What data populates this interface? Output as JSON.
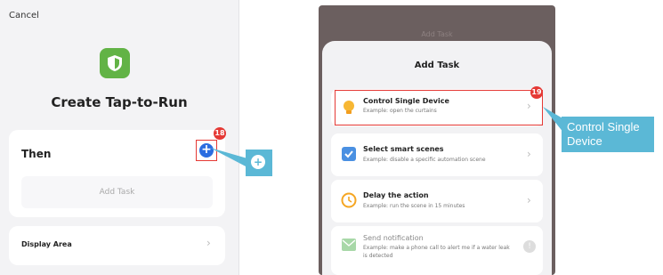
{
  "left_screen": {
    "cancel_label": "Cancel",
    "title": "Create Tap-to-Run",
    "then_label": "Then",
    "add_button_glyph": "+",
    "step_badge": "18",
    "add_task_placeholder": "Add Task",
    "display_area_label": "Display Area",
    "chevron_glyph": "›",
    "icons": [
      "shield-logo-icon",
      "plus-icon",
      "chevron-right-icon"
    ],
    "accent_color": "#2b6de0",
    "logo_color": "#62b346"
  },
  "left_callout": {
    "glyph": "+",
    "color": "#5bb8d6"
  },
  "right_screen": {
    "dimmed_title": "Add Task",
    "sheet_title": "Add Task",
    "step_badge": "19",
    "items": [
      {
        "title": "Control Single Device",
        "subtitle": "Example: open the curtains",
        "icon": "lightbulb-icon",
        "chevron": "›"
      },
      {
        "title": "Select smart scenes",
        "subtitle": "Example: disable a specific automation scene",
        "icon": "checkbox-icon",
        "chevron": "›"
      },
      {
        "title": "Delay the action",
        "subtitle": "Example: run the scene in 15 minutes",
        "icon": "clock-icon",
        "chevron": "›"
      },
      {
        "title": "Send notification",
        "subtitle": "Example: make a phone call to alert me if a water leak is detected",
        "icon": "envelope-icon",
        "chevron": "!"
      }
    ]
  },
  "right_callout": {
    "text": "Control Single Device",
    "color": "#5bb8d6"
  },
  "highlight_color": "#e53935"
}
